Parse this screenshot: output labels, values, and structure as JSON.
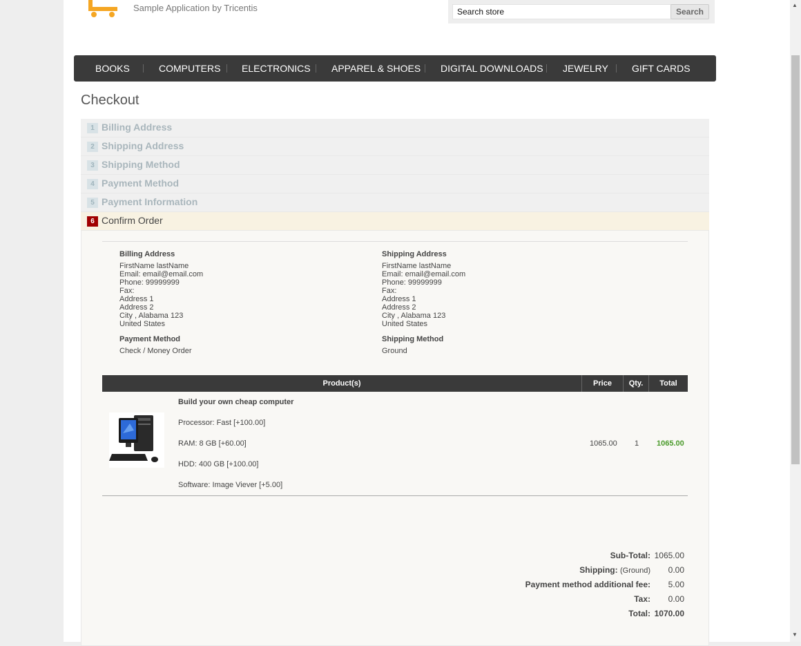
{
  "header": {
    "tagline": "Sample Application by Tricentis",
    "search_placeholder": "Search store",
    "search_button": "Search",
    "accent_color": "#f5a623"
  },
  "menu": {
    "items": [
      "BOOKS",
      "COMPUTERS",
      "ELECTRONICS",
      "APPAREL & SHOES",
      "DIGITAL DOWNLOADS",
      "JEWELRY",
      "GIFT CARDS"
    ]
  },
  "page_title": "Checkout",
  "steps": [
    {
      "num": "1",
      "title": "Billing Address"
    },
    {
      "num": "2",
      "title": "Shipping Address"
    },
    {
      "num": "3",
      "title": "Shipping Method"
    },
    {
      "num": "4",
      "title": "Payment Method"
    },
    {
      "num": "5",
      "title": "Payment Information"
    },
    {
      "num": "6",
      "title": "Confirm Order"
    }
  ],
  "billing": {
    "heading": "Billing Address",
    "name": "FirstName lastName",
    "email": "Email: email@email.com",
    "phone": "Phone: 99999999",
    "fax": "Fax:",
    "address1": "Address 1",
    "address2": "Address 2",
    "city": "City , Alabama 123",
    "country": "United States"
  },
  "shipping": {
    "heading": "Shipping Address",
    "name": "FirstName lastName",
    "email": "Email: email@email.com",
    "phone": "Phone: 99999999",
    "fax": "Fax:",
    "address1": "Address 1",
    "address2": "Address 2",
    "city": "City , Alabama 123",
    "country": "United States"
  },
  "payment_method": {
    "heading": "Payment Method",
    "value": "Check / Money Order"
  },
  "shipping_method": {
    "heading": "Shipping Method",
    "value": "Ground"
  },
  "table": {
    "headers": {
      "product": "Product(s)",
      "price": "Price",
      "qty": "Qty.",
      "total": "Total"
    },
    "rows": [
      {
        "name": "Build your own cheap computer",
        "attributes": [
          "Processor: Fast [+100.00]",
          "RAM: 8 GB [+60.00]",
          "HDD: 400 GB [+100.00]",
          "Software: Image Viever [+5.00]"
        ],
        "price": "1065.00",
        "qty": "1",
        "total": "1065.00"
      }
    ]
  },
  "totals": {
    "subtotal_label": "Sub-Total:",
    "subtotal": "1065.00",
    "shipping_label": "Shipping:",
    "shipping_method": "(Ground)",
    "shipping": "0.00",
    "fee_label": "Payment method additional fee:",
    "fee": "5.00",
    "tax_label": "Tax:",
    "tax": "0.00",
    "total_label": "Total:",
    "total": "1070.00"
  }
}
